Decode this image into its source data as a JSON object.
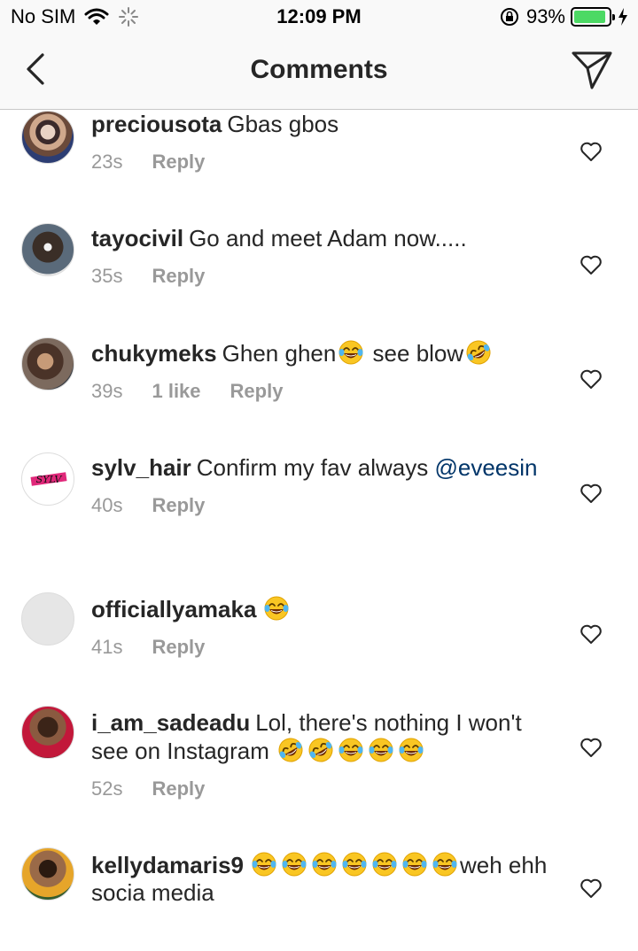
{
  "status_bar": {
    "carrier": "No SIM",
    "time": "12:09 PM",
    "battery_percent": "93%",
    "battery_level": 0.93
  },
  "nav": {
    "title": "Comments",
    "back_icon": "chevron-left-icon",
    "share_icon": "paper-plane-icon"
  },
  "comments": [
    {
      "username": "preciousota",
      "parts": [
        {
          "t": "text",
          "v": "Gbas gbos"
        }
      ],
      "time": "23s",
      "likes": "",
      "reply": "Reply"
    },
    {
      "username": "tayocivil",
      "parts": [
        {
          "t": "text",
          "v": "Go and meet Adam now....."
        }
      ],
      "time": "35s",
      "likes": "",
      "reply": "Reply"
    },
    {
      "username": "chukymeks",
      "parts": [
        {
          "t": "text",
          "v": "Ghen ghen"
        },
        {
          "t": "emoji",
          "v": "joy"
        },
        {
          "t": "text",
          "v": " see blow"
        },
        {
          "t": "emoji",
          "v": "rofl"
        }
      ],
      "time": "39s",
      "likes": "1 like",
      "reply": "Reply"
    },
    {
      "username": "sylv_hair",
      "parts": [
        {
          "t": "text",
          "v": "Confirm my fav always "
        },
        {
          "t": "mention",
          "v": "@eveesin"
        }
      ],
      "time": "40s",
      "likes": "",
      "reply": "Reply"
    },
    {
      "username": "officiallyamaka",
      "parts": [
        {
          "t": "emoji",
          "v": "joy"
        }
      ],
      "time": "41s",
      "likes": "",
      "reply": "Reply"
    },
    {
      "username": "i_am_sadeadu",
      "parts": [
        {
          "t": "text",
          "v": "Lol, there's nothing I won't see on Instagram "
        },
        {
          "t": "emoji",
          "v": "rofl"
        },
        {
          "t": "emoji",
          "v": "rofl"
        },
        {
          "t": "emoji",
          "v": "joy"
        },
        {
          "t": "emoji",
          "v": "joy"
        },
        {
          "t": "emoji",
          "v": "joy"
        }
      ],
      "time": "52s",
      "likes": "",
      "reply": "Reply"
    },
    {
      "username": "kellydamaris9",
      "parts": [
        {
          "t": "emoji",
          "v": "joy"
        },
        {
          "t": "emoji",
          "v": "joy"
        },
        {
          "t": "emoji",
          "v": "joy"
        },
        {
          "t": "emoji",
          "v": "joy"
        },
        {
          "t": "emoji",
          "v": "joy"
        },
        {
          "t": "emoji",
          "v": "joy"
        },
        {
          "t": "emoji",
          "v": "joy"
        },
        {
          "t": "text",
          "v": "weh ehh socia media"
        }
      ],
      "time": "",
      "likes": "",
      "reply": ""
    }
  ],
  "colors": {
    "text": "#262626",
    "meta": "#999999",
    "mention": "#003569",
    "battery": "#4cd964",
    "bar_bg": "#f9f9f9"
  }
}
